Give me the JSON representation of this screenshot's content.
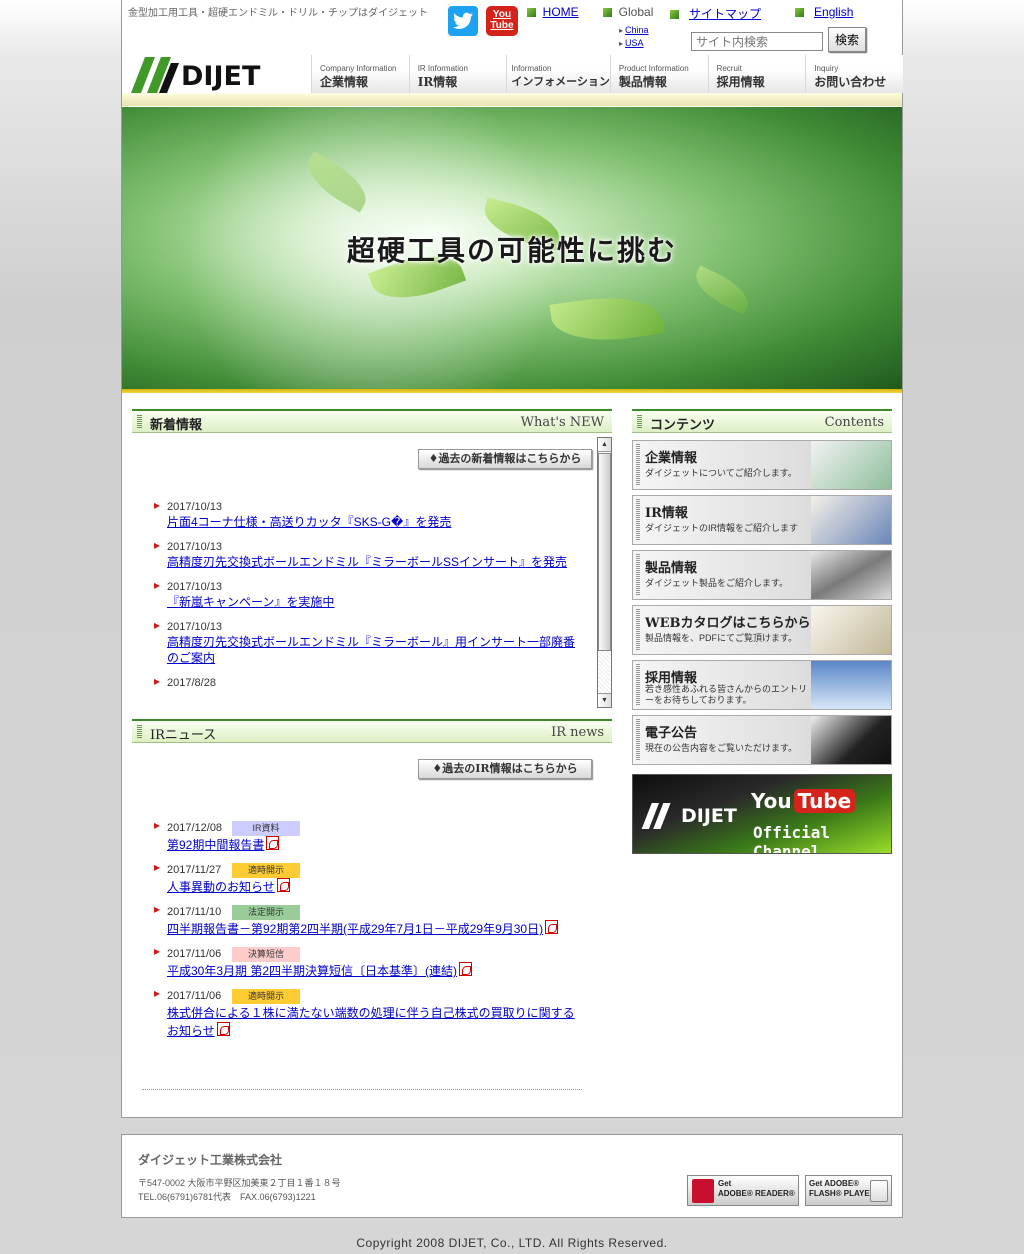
{
  "header": {
    "tagline": "金型加工用工具・超硬エンドミル・ドリル・チップはダイジェット",
    "twitter_icon": "twitter-bird-icon",
    "youtube_icon_text_1": "You",
    "youtube_icon_text_2": "Tube",
    "home": "HOME",
    "global": "Global",
    "global_links": [
      "China",
      "USA"
    ],
    "sitemap": "サイトマップ",
    "english": "English",
    "search_placeholder": "サイト内検索",
    "search_button": "検索",
    "logo_text": "DIJET"
  },
  "nav": [
    {
      "en": "Company Information",
      "jp": "企業情報"
    },
    {
      "en": "IR Information",
      "jp": "IR情報"
    },
    {
      "en": "Information",
      "jp": "インフォメーション"
    },
    {
      "en": "Product Information",
      "jp": "製品情報"
    },
    {
      "en": "Recruit",
      "jp": "採用情報"
    },
    {
      "en": "Inquiry",
      "jp": "お問い合わせ"
    }
  ],
  "hero": {
    "title": "超硬工具の可能性に挑む"
  },
  "news": {
    "heading": "新着情報",
    "heading_en": "What's NEW",
    "past_button": "過去の新着情報はこちらから",
    "items": [
      {
        "date": "2017/10/13",
        "title": "片面4コーナ仕様・高送りカッタ『SKS-G�』を発売"
      },
      {
        "date": "2017/10/13",
        "title": "高精度刃先交換式ボールエンドミル『ミラーボールSSインサート』を発売"
      },
      {
        "date": "2017/10/13",
        "title": "『新嵐キャンペーン』を実施中"
      },
      {
        "date": "2017/10/13",
        "title": "高精度刃先交換式ボールエンドミル『ミラーボール』用インサート一部廃番のご案内"
      },
      {
        "date": "2017/8/28",
        "title": ""
      }
    ]
  },
  "ir": {
    "heading": "IRニュース",
    "heading_en": "IR news",
    "past_button": "過去のIR情報はこちらから",
    "items": [
      {
        "date": "2017/12/08",
        "badge": "IR資料",
        "badge_color": "#ccccff",
        "title": "第92期中間報告書"
      },
      {
        "date": "2017/11/27",
        "badge": "適時開示",
        "badge_color": "#ffcc33",
        "title": "人事異動のお知らせ"
      },
      {
        "date": "2017/11/10",
        "badge": "法定開示",
        "badge_color": "#99cc99",
        "title": "四半期報告書－第92期第2四半期(平成29年7月1日－平成29年9月30日)"
      },
      {
        "date": "2017/11/06",
        "badge": "決算短信",
        "badge_color": "#ffcccc",
        "title": "平成30年3月期 第2四半期決算短信〔日本基準〕(連結)"
      },
      {
        "date": "2017/11/06",
        "badge": "適時開示",
        "badge_color": "#ffcc33",
        "title": "株式併合による１株に満たない端数の処理に伴う自己株式の買取りに関するお知らせ"
      }
    ]
  },
  "contents": {
    "heading": "コンテンツ",
    "heading_en": "Contents",
    "cards": [
      {
        "title": "企業情報",
        "desc": "ダイジェットについてご紹介します。"
      },
      {
        "title": "IR情報",
        "desc": "ダイジェットのIR情報をご紹介します"
      },
      {
        "title": "製品情報",
        "desc": "ダイジェット製品をご紹介します。"
      },
      {
        "title": "WEBカタログはこちらから",
        "desc": "製品情報を、PDFにてご覧頂けます。"
      },
      {
        "title": "採用情報",
        "desc": "若き感性あふれる皆さんからのエントリーをお待ちしております。"
      },
      {
        "title": "電子公告",
        "desc": "現在の公告内容をご覧いただけます。"
      }
    ],
    "youtube_banner": {
      "logo": "DIJET",
      "brand_1": "You",
      "brand_2": "Tube",
      "channel": "Official Channel"
    }
  },
  "footer": {
    "company": "ダイジェット工業株式会社",
    "address": "〒547-0002 大阪市平野区加美東２丁目１番１８号",
    "tel": "TEL.06(6791)6781代表　FAX.06(6793)1221",
    "reader_1": "Get",
    "reader_2": "ADOBE® READER®",
    "flash_1": "Get ADOBE®",
    "flash_2": "FLASH® PLAYER",
    "copyright": "Copyright 2008 DIJET, Co., LTD. All Rights Reserved."
  }
}
